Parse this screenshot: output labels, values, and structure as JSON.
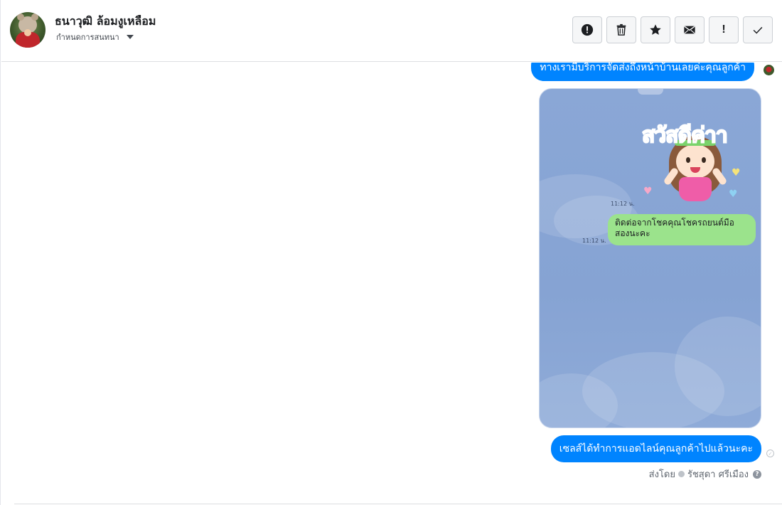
{
  "contact": {
    "name": "ธนาวุฒิ ล้อมงูเหลือม",
    "assign_label": "กำหนดการสนทนา"
  },
  "toolbar": {
    "buttons": [
      {
        "name": "spam",
        "icon": "alert-circle-icon"
      },
      {
        "name": "delete",
        "icon": "trash-icon"
      },
      {
        "name": "star",
        "icon": "star-icon"
      },
      {
        "name": "unread",
        "icon": "envelope-icon"
      },
      {
        "name": "important",
        "icon": "exclamation-icon",
        "glyph": "!"
      },
      {
        "name": "done",
        "icon": "checkmark-icon"
      }
    ]
  },
  "messages": {
    "top_bubble": "ทางเรามีบริการจัดส่งถึงหน้าบ้านเลยค่ะคุณลูกค้า",
    "bottom_bubble": "เซลส์ได้ทำการแอดไลน์คุณลูกค้าไปแล้วนะคะ"
  },
  "attachment": {
    "sticker_text": "สวัสดีค่าา",
    "timestamp_1": "11:12 น.",
    "green_bubble": "ติดต่อจากโชคคุณโชครถยนต์มือสองนะคะ",
    "timestamp_2": "11:12 น."
  },
  "sent_by": {
    "label": "ส่งโดย",
    "agent": "รัชสุดา ศรีเมือง"
  },
  "colors": {
    "accent": "#0084ff",
    "line_green": "#9be38c",
    "attachment_bg": "#8aa7d6"
  }
}
